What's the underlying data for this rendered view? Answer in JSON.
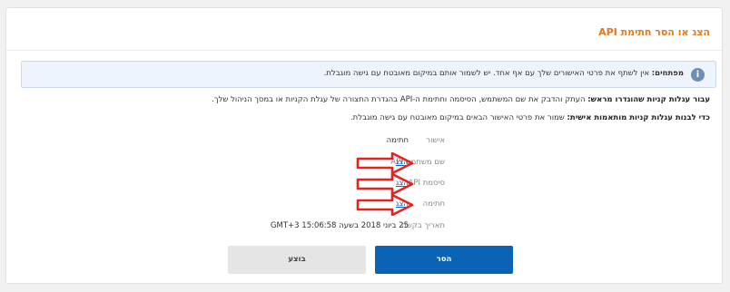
{
  "title": "הצג או הסר חתימת API",
  "info": {
    "icon": "info-icon",
    "bold": "מפתחים:",
    "text": " אין לשתף את פרטי האישורים שלך עם אף אחד. יש לשמור אותם במיקום מאובטח עם גישה מוגבלת."
  },
  "para1": {
    "bold": "עבור עגלות קניות שהוגדרו מראש:",
    "text": " העתק והדבק את שם המשתמש, הסיסמה וחתימת ה-API בהגדרת התצורה של עגלת הקניות או במסך הניהול שלך."
  },
  "para2": {
    "bold": "כדי לבנות עגלות קניות מותאמות אישית:",
    "text": " שמור את פרטי האישור הבאים במיקום מאובטח עם גישה מוגבלת."
  },
  "table": {
    "credential_header": "אישור",
    "signature_header": "חתימה",
    "rows": [
      {
        "label": "שם משתמש API",
        "link": "הצג"
      },
      {
        "label": "סיסמת API",
        "link": "הצג"
      },
      {
        "label": "חתימה",
        "link": "הצג"
      }
    ],
    "request_date_label": "תאריך בקשה",
    "request_date_value": "25 ביוני 2018 בשעה 15:06:58 GMT+3"
  },
  "buttons": {
    "remove": "הסר",
    "done": "בוצע"
  },
  "colors": {
    "title": "#e07a1f",
    "link": "#1a63b8",
    "primary_button": "#0b63b6",
    "annotation_arrow": "#e8211b"
  }
}
